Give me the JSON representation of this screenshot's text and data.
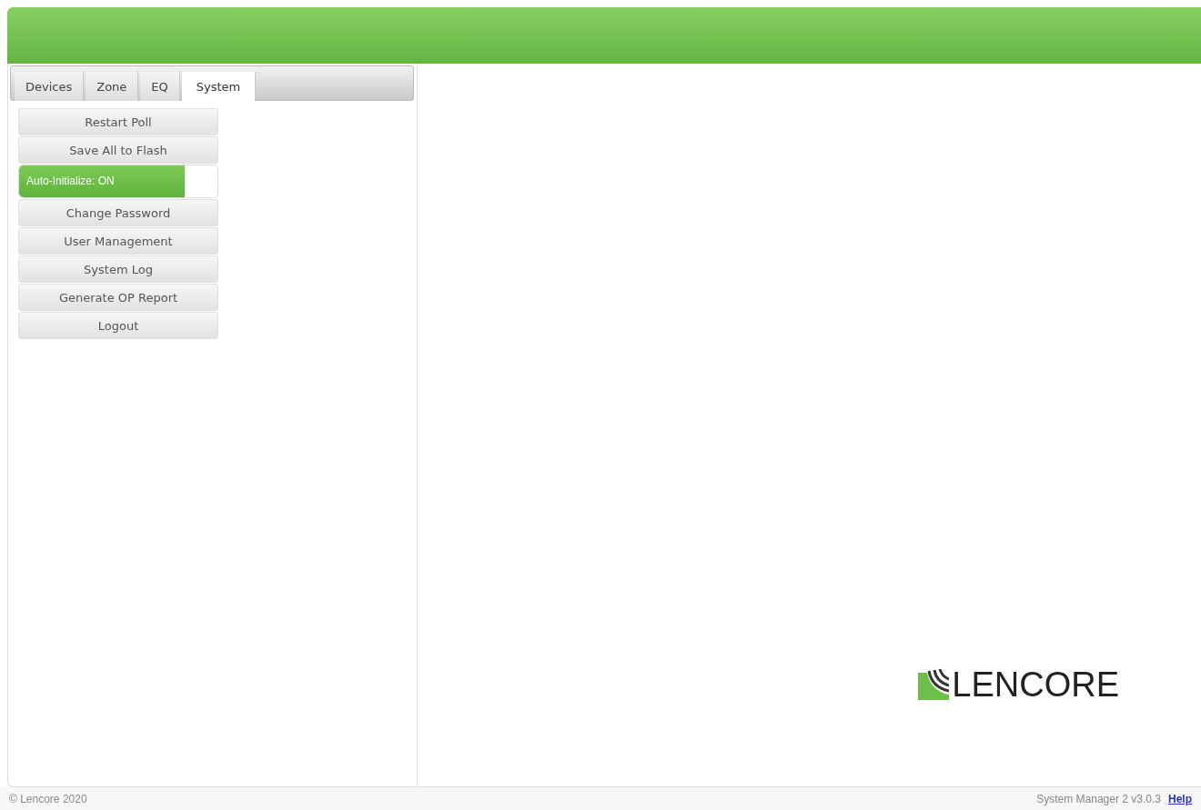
{
  "tabs": [
    {
      "label": "Devices",
      "selected": false
    },
    {
      "label": "Zone",
      "selected": false
    },
    {
      "label": "EQ",
      "selected": false
    },
    {
      "label": "System",
      "selected": true
    }
  ],
  "menu": [
    {
      "kind": "button",
      "label": "Restart Poll"
    },
    {
      "kind": "button",
      "label": "Save All to Flash"
    },
    {
      "kind": "toggle",
      "label": "Auto-Initialize: ON",
      "on": true
    },
    {
      "kind": "button",
      "label": "Change Password"
    },
    {
      "kind": "button",
      "label": "User Management"
    },
    {
      "kind": "button",
      "label": "System Log"
    },
    {
      "kind": "button",
      "label": "Generate OP Report"
    },
    {
      "kind": "button",
      "label": "Logout"
    }
  ],
  "logo": {
    "text": "LENCORE"
  },
  "footer": {
    "copyright": "© Lencore 2020",
    "version": "System Manager 2 v3.0.3",
    "help_link": "Help"
  }
}
